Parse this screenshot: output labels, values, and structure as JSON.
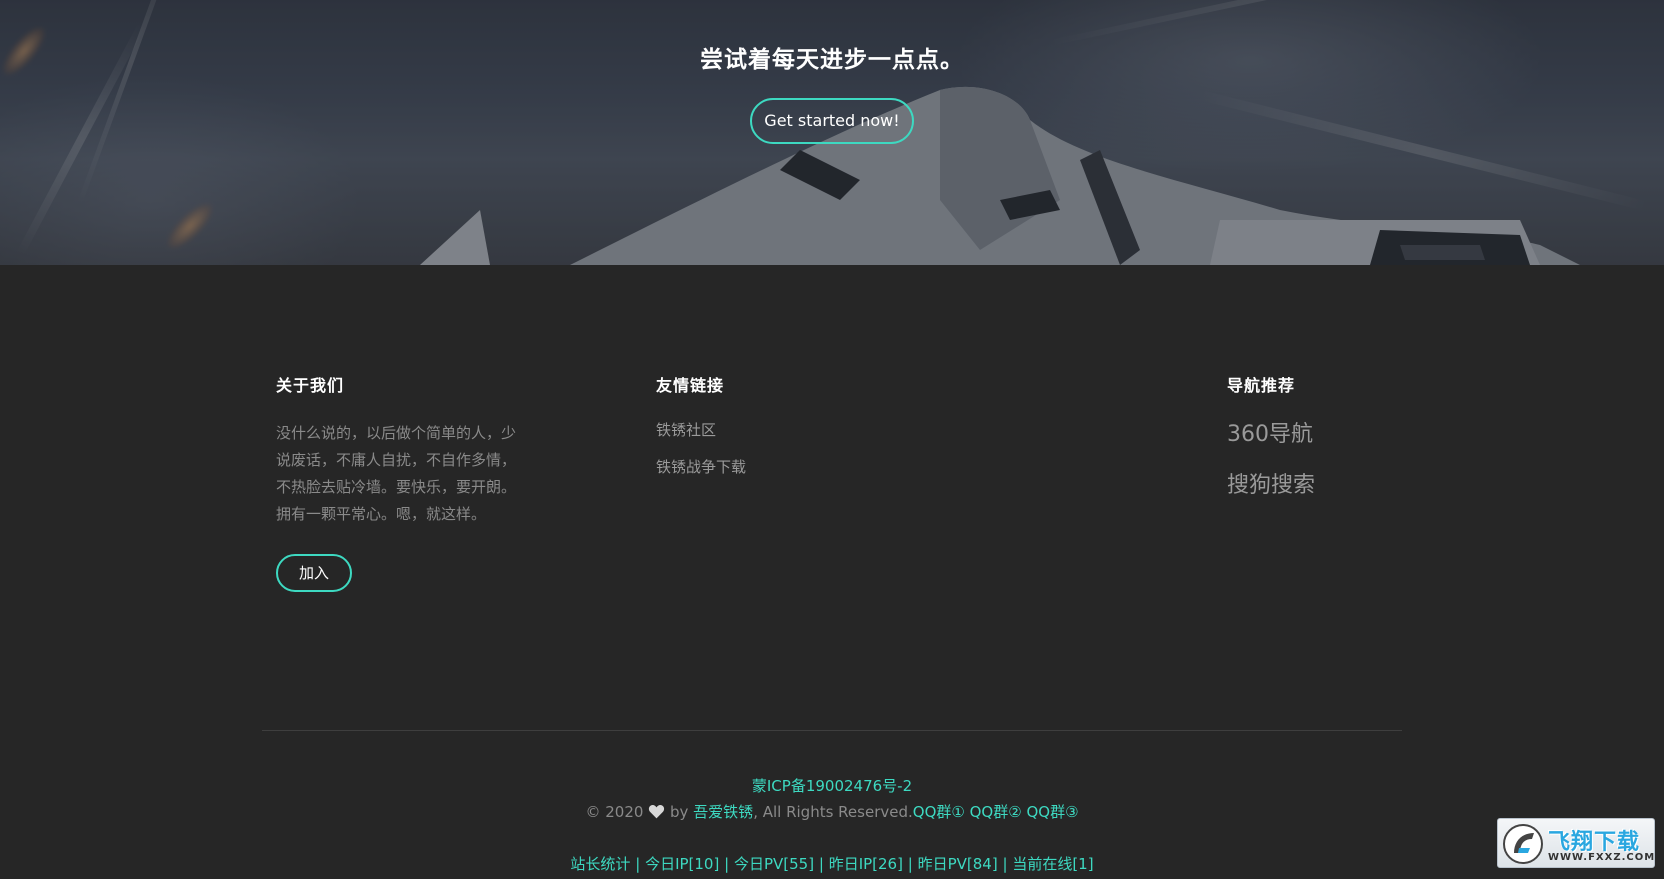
{
  "hero": {
    "title": "尝试着每天进步一点点。",
    "cta_label": "Get started now!"
  },
  "about": {
    "heading": "关于我们",
    "text": "没什么说的，以后做个简单的人，少说废话，不庸人自扰，不自作多情，不热脸去贴冷墙。要快乐，要开朗。拥有一颗平常心。嗯，就这样。",
    "join_label": "加入"
  },
  "links": {
    "heading": "友情链接",
    "items": [
      {
        "label": "铁锈社区"
      },
      {
        "label": "铁锈战争下载"
      }
    ]
  },
  "nav": {
    "heading": "导航推荐",
    "items": [
      {
        "label": "360导航"
      },
      {
        "label": "搜狗搜索"
      }
    ]
  },
  "footer": {
    "icp": "蒙ICP备19002476号-2",
    "copyright_prefix": "© 2020",
    "by_text": "by",
    "author": "吾爱铁锈",
    "rights": ", All Rights Reserved.",
    "qq1": "QQ群①",
    "qq2": "QQ群②",
    "qq3": "QQ群③",
    "stats": [
      {
        "label": "站长统计"
      },
      {
        "label": "今日IP[10]"
      },
      {
        "label": "今日PV[55]"
      },
      {
        "label": "昨日IP[26]"
      },
      {
        "label": "昨日PV[84]"
      },
      {
        "label": "当前在线[1]"
      }
    ],
    "separator": "|"
  },
  "watermark": {
    "title": "飞翔下载",
    "url": "WWW.FXXZ.COM"
  },
  "colors": {
    "accent": "#3dd9c1",
    "background": "#262626",
    "muted_text": "#8a8a8a"
  }
}
